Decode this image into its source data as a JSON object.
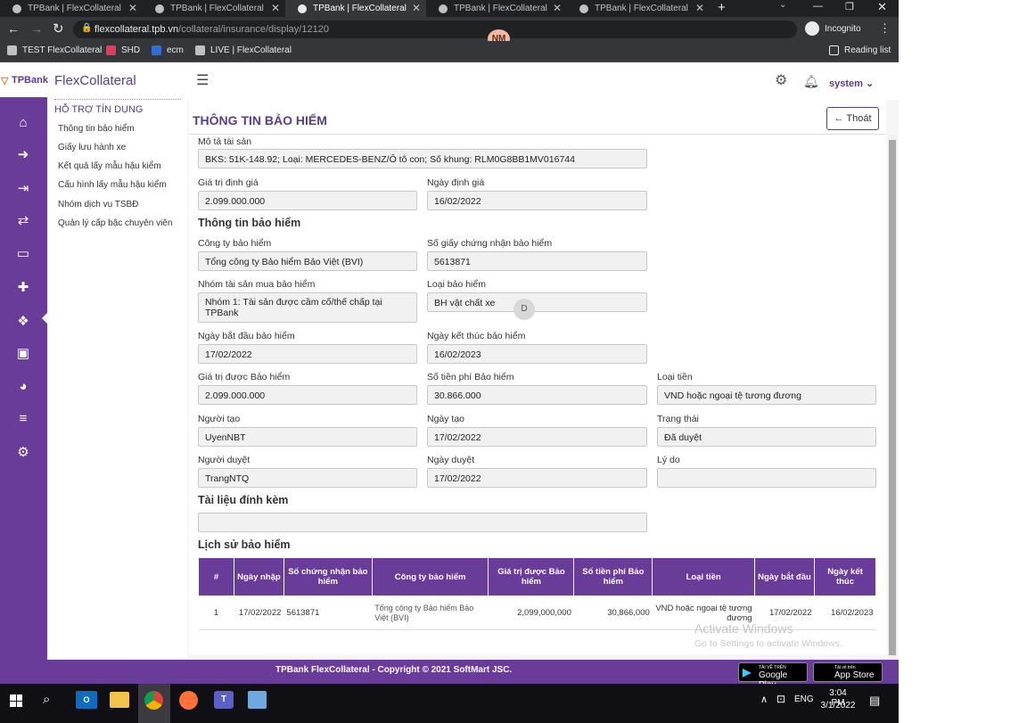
{
  "browser": {
    "tabs": [
      {
        "label": "TPBank | FlexCollateral",
        "active": false
      },
      {
        "label": "TPBank | FlexCollateral",
        "active": false
      },
      {
        "label": "TPBank | FlexCollateral",
        "active": true
      },
      {
        "label": "TPBank | FlexCollateral",
        "active": false
      },
      {
        "label": "TPBank | FlexCollateral",
        "active": false
      }
    ],
    "url_domain": "flexcollateral.tpb.vn",
    "url_path": "/collateral/insurance/display/12120",
    "profile_initials": "NM",
    "incognito_label": "Incognito",
    "reading_list_label": "Reading list",
    "bookmarks": [
      "TEST FlexCollateral",
      "SHD",
      "ecm",
      "LIVE | FlexCollateral"
    ]
  },
  "app": {
    "brand_logo": "TPBank",
    "app_name": "FlexCollateral",
    "user_label": "system"
  },
  "menu": {
    "heading": "HỖ TRỢ TÍN DỤNG",
    "items": [
      "Thông tin bảo hiểm",
      "Giấy lưu hành xe",
      "Kết quả lấy mẫu hậu kiểm",
      "Cấu hình lấy mẫu hậu kiểm",
      "Nhóm dịch vụ TSBĐ",
      "Quản lý cấp bậc chuyên viên"
    ]
  },
  "page": {
    "title": "THÔNG TIN BẢO HIỂM",
    "back_label": "Thoát",
    "asset_desc_label": "Mô tả tài sản",
    "asset_desc": "BKS: 51K-148.92; Loại: MERCEDES-BENZ/Ô tô con; Số khung: RLM0G8BB1MV016744",
    "valuation_label": "Giá trị định giá",
    "valuation": "2.099.000.000",
    "valuation_date_label": "Ngày định giá",
    "valuation_date": "16/02/2022",
    "insurance_section": "Thông tin bảo hiểm",
    "company_label": "Công ty bảo hiểm",
    "company": "Tổng công ty Bảo hiểm Bảo Việt (BVI)",
    "cert_label": "Số giấy chứng nhận bảo hiểm",
    "cert": "5613871",
    "asset_group_label": "Nhóm tài sản mua bảo hiểm",
    "asset_group": "Nhóm 1: Tài sản được cầm cố/thế chấp tại TPBank",
    "ins_type_label": "Loại bảo hiểm",
    "ins_type": "BH vật chất xe",
    "start_label": "Ngày bắt đầu bảo hiểm",
    "start": "17/02/2022",
    "end_label": "Ngày kết thúc bảo hiểm",
    "end": "16/02/2023",
    "insured_value_label": "Giá trị được Bảo hiểm",
    "insured_value": "2.099.000.000",
    "premium_label": "Số tiền phí Bảo hiểm",
    "premium": "30.866.000",
    "currency_label": "Loại tiền",
    "currency": "VND hoặc ngoại tệ tương đương",
    "creator_label": "Người tạo",
    "creator": "UyenNBT",
    "created_label": "Ngày tạo",
    "created": "17/02/2022",
    "status_label": "Trạng thái",
    "status": "Đã duyệt",
    "approver_label": "Người duyệt",
    "approver": "TrangNTQ",
    "approved_label": "Ngày duyệt",
    "approved": "17/02/2022",
    "reason_label": "Lý do",
    "reason": "",
    "attach_section": "Tài liệu đính kèm",
    "history_section": "Lịch sử bảo hiểm"
  },
  "history": {
    "headers": [
      "#",
      "Ngày nhập",
      "Số chứng nhận bảo hiểm",
      "Công ty bảo hiểm",
      "Giá trị được Bảo hiểm",
      "Số tiền phí Bảo hiểm",
      "Loại tiền",
      "Ngày bắt đầu",
      "Ngày kết thúc"
    ],
    "rows": [
      [
        "1",
        "17/02/2022",
        "5613871",
        "Tổng công ty Bảo hiểm Bảo Việt (BVI)",
        "2,099,000,000",
        "30,866,000",
        "VND hoặc ngoại tệ tương đương",
        "17/02/2022",
        "16/02/2023"
      ]
    ]
  },
  "cursor_badge": "D",
  "watermark": {
    "line1": "Activate Windows",
    "line2": "Go to Settings to activate Windows."
  },
  "footer": {
    "copyright": "TPBank FlexCollateral - Copyright © 2021 SoftMart JSC.",
    "google_play_small": "TẢI VỀ TRÊN",
    "google_play": "Google Play",
    "app_store_small": "Tải về trên",
    "app_store": "App Store"
  },
  "taskbar": {
    "lang": "ENG",
    "time": "3:04 PM",
    "date": "3/1/2022"
  },
  "colors": {
    "brand_purple": "#6a3c9a",
    "title_purple": "#5a3c8e",
    "tp_orange": "#f47b20"
  }
}
